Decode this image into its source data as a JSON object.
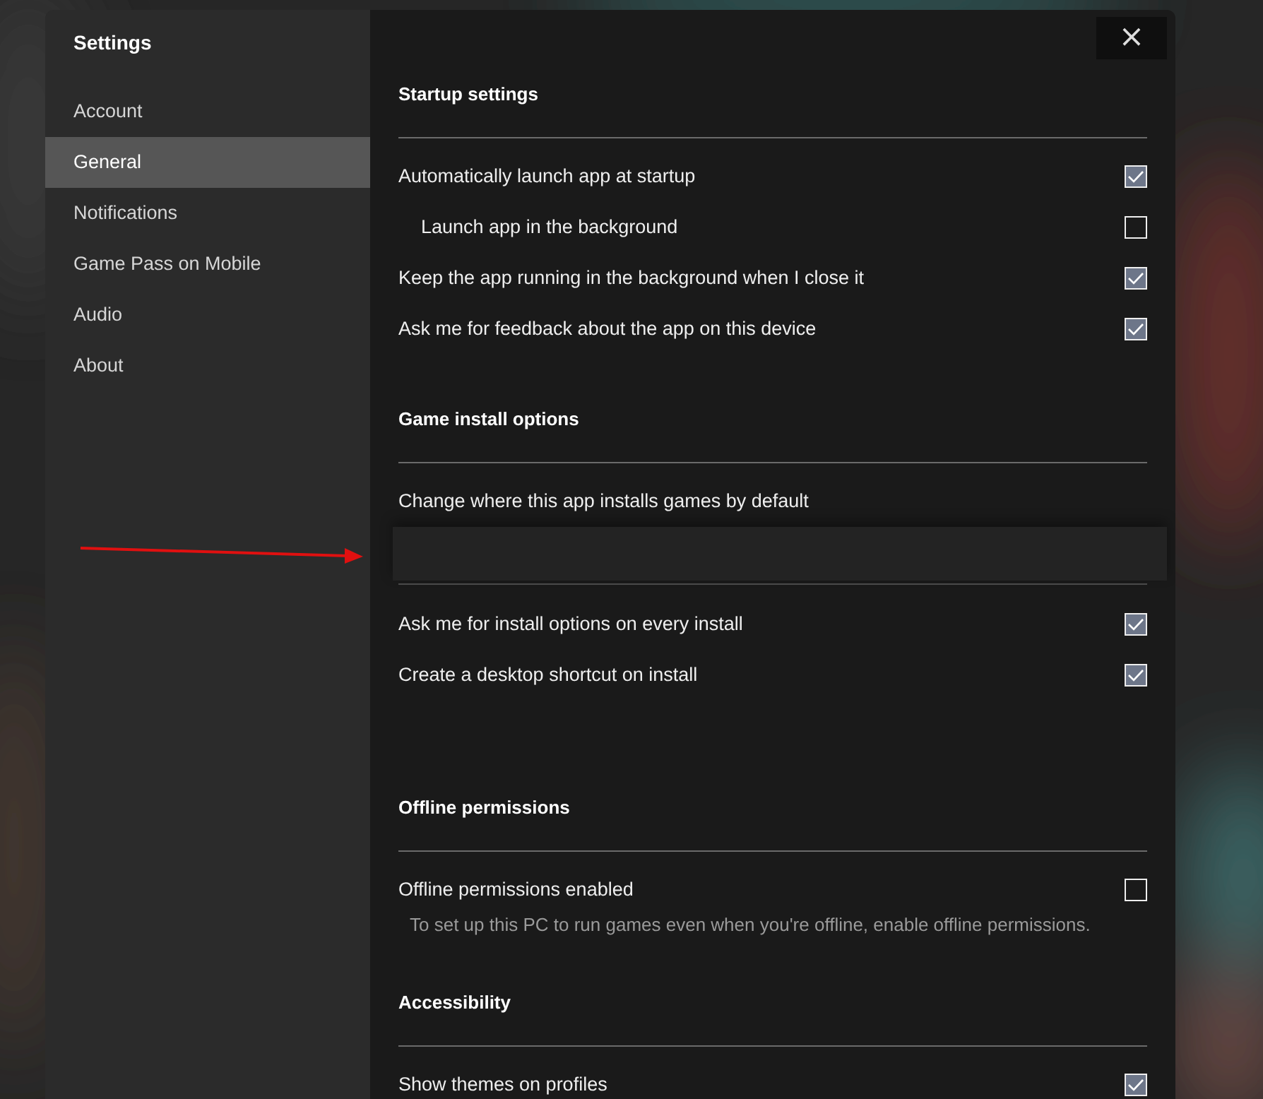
{
  "sidebar": {
    "title": "Settings",
    "items": [
      {
        "label": "Account",
        "selected": false
      },
      {
        "label": "General",
        "selected": true
      },
      {
        "label": "Notifications",
        "selected": false
      },
      {
        "label": "Game Pass on Mobile",
        "selected": false
      },
      {
        "label": "Audio",
        "selected": false
      },
      {
        "label": "About",
        "selected": false
      }
    ]
  },
  "close_button": "×",
  "sections": [
    {
      "title": "Startup settings",
      "items": [
        {
          "kind": "checkbox",
          "label": "Automatically launch app at startup",
          "checked": true,
          "children": [
            {
              "kind": "checkbox",
              "label": "Launch app in the background",
              "checked": false
            }
          ]
        },
        {
          "kind": "checkbox",
          "label": "Keep the app running in the background when I close it",
          "checked": true
        },
        {
          "kind": "checkbox",
          "label": "Ask me for feedback about the app on this device",
          "checked": true
        }
      ]
    },
    {
      "title": "Game install options",
      "items": [
        {
          "kind": "location",
          "label": "Change where this app installs games by default"
        },
        {
          "kind": "checkbox",
          "label": "Ask me for install options on every install",
          "checked": true
        },
        {
          "kind": "checkbox",
          "label": "Create a desktop shortcut on install",
          "checked": true
        }
      ]
    },
    {
      "title": "Offline permissions",
      "items": [
        {
          "kind": "checkbox",
          "label": "Offline permissions enabled",
          "checked": false
        },
        {
          "kind": "description",
          "label": "To set up this PC to run games even when you're offline, enable offline permissions."
        }
      ]
    },
    {
      "title": "Accessibility",
      "items": [
        {
          "kind": "checkbox",
          "label": "Show themes on profiles",
          "checked": true
        }
      ]
    }
  ]
}
